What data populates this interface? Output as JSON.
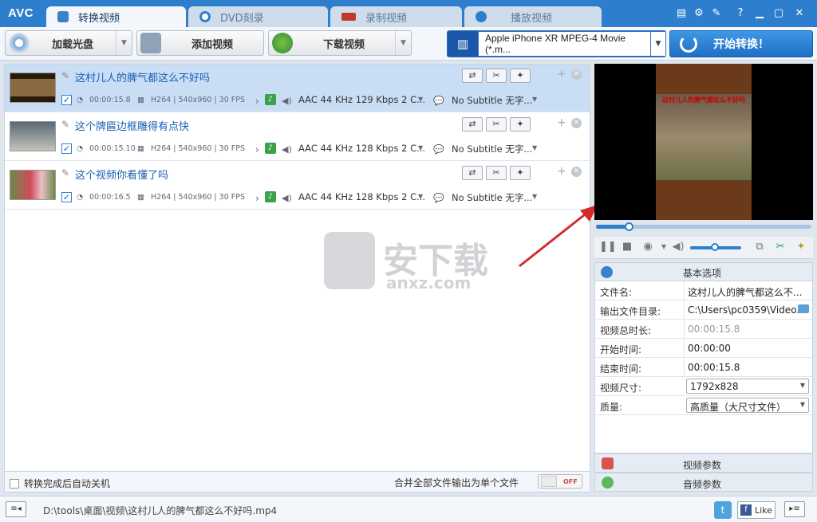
{
  "app": {
    "logo": "AVC",
    "tabs": [
      {
        "label": "转换视频",
        "active": true,
        "icon": "convert-icon"
      },
      {
        "label": "DVD刻录",
        "active": false,
        "icon": "disc-icon"
      },
      {
        "label": "录制视频",
        "active": false,
        "icon": "record-icon"
      },
      {
        "label": "播放视频",
        "active": false,
        "icon": "play-icon"
      }
    ],
    "window_controls": [
      "registration-icon",
      "settings-icon",
      "tools-icon",
      "help-icon",
      "minimize-icon",
      "maximize-icon",
      "close-icon"
    ]
  },
  "toolbar": {
    "load_disc": "加载光盘",
    "add_video": "添加视频",
    "download_video": "下载视频",
    "profile": "Apple iPhone XR MPEG-4 Movie (*.m...",
    "start": "开始转换！"
  },
  "files": [
    {
      "name": "这村儿人的脾气都这么不好吗",
      "duration": "00:00:15.8",
      "video_info": "H264 | 540x960 | 30 FPS",
      "audio": "AAC 44 KHz 129 Kbps 2 C...",
      "subtitle": "No Subtitle 无字...",
      "selected": true
    },
    {
      "name": "这个牌匾边框雕得有点快",
      "duration": "00:00:15.10",
      "video_info": "H264 | 540x960 | 30 FPS",
      "audio": "AAC 44 KHz 128 Kbps 2 C...",
      "subtitle": "No Subtitle 无字...",
      "selected": false
    },
    {
      "name": "这个视频你看懂了吗",
      "duration": "00:00:16.5",
      "video_info": "H264 | 540x960 | 30 FPS",
      "audio": "AAC 44 KHz 128 Kbps 2 C...",
      "subtitle": "No Subtitle 无字...",
      "selected": false
    }
  ],
  "watermark": {
    "text": "安下载",
    "sub": "anxz.com"
  },
  "bottom": {
    "auto_shutdown": "转换完成后自动关机",
    "merge_all": "合并全部文件输出为单个文件",
    "toggle_state": "OFF"
  },
  "preview": {
    "frame_caption": "这村儿人的脾气都这么不好吗",
    "progress": 0.15
  },
  "properties": {
    "header": "基本选项",
    "rows": [
      {
        "label": "文件名:",
        "value": "这村儿人的脾气都这么不..."
      },
      {
        "label": "输出文件目录:",
        "value": "C:\\Users\\pc0359\\Video..."
      },
      {
        "label": "视频总时长:",
        "value": "00:00:15.8"
      },
      {
        "label": "开始时间:",
        "value": "00:00:00"
      },
      {
        "label": "结束时间:",
        "value": "00:00:15.8"
      },
      {
        "label": "视频尺寸:",
        "value": "1792x828"
      },
      {
        "label": "质量:",
        "value": "高质量（大尺寸文件）"
      }
    ],
    "video_params": "视频参数",
    "audio_params": "音频参数"
  },
  "statusbar": {
    "path": "D:\\tools\\桌面\\视频\\这村儿人的脾气都这么不好吗.mp4",
    "like": "Like"
  },
  "colors": {
    "accent": "#2d7fcd",
    "selected_row": "#c9def4",
    "title_bar": "#2d7fcd"
  }
}
